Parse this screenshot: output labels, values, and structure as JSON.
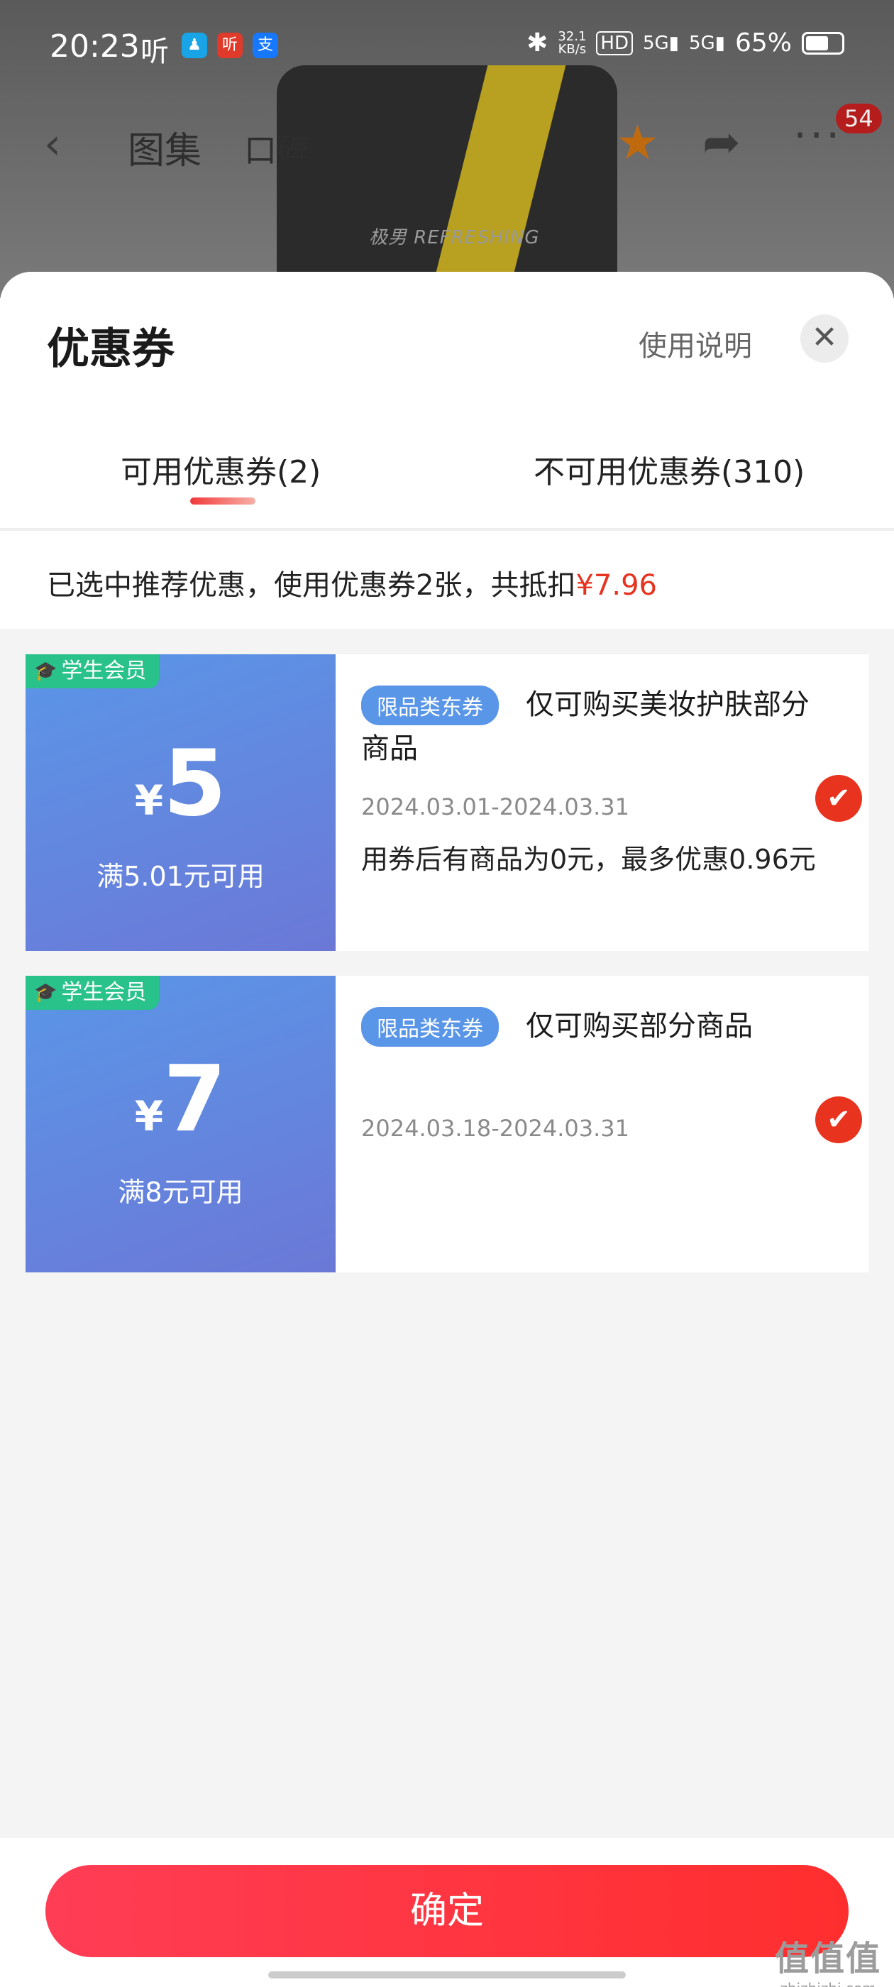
{
  "status_bar": {
    "time": "20:23",
    "ting": "听",
    "app_icons": [
      "qq-icon",
      "ting-app-icon",
      "alipay-icon"
    ],
    "net_speed_value": "32.1",
    "net_speed_unit": "KB/s",
    "battery": "65%",
    "battery_level": 0.65
  },
  "navbar": {
    "tabs": [
      "图集",
      "口碑"
    ],
    "more_badge": "54"
  },
  "product": {
    "visible_text": "极男  REFRESHING"
  },
  "sheet": {
    "title": "优惠券",
    "help_label": "使用说明",
    "close_label": "✕",
    "tabs": {
      "available": "可用优惠券(2)",
      "unavailable": "不可用优惠券(310)"
    },
    "summary": {
      "text": "已选中推荐优惠，使用优惠券2张，共抵扣",
      "amount": "¥7.96"
    }
  },
  "coupons": [
    {
      "member_tag": "学生会员",
      "yen": "¥",
      "amount": "5",
      "threshold": "满5.01元可用",
      "type_tag": "限品类东券",
      "description": "仅可购买美妆护肤部分商品",
      "validity": "2024.03.01-2024.03.31",
      "note": "用券后有商品为0元，最多优惠0.96元",
      "selected": true
    },
    {
      "member_tag": "学生会员",
      "yen": "¥",
      "amount": "7",
      "threshold": "满8元可用",
      "type_tag": "限品类东券",
      "description": "仅可购买部分商品",
      "validity": "2024.03.18-2024.03.31",
      "note": "",
      "selected": true
    }
  ],
  "footer": {
    "confirm_label": "确定",
    "watermark": "值值值",
    "watermark_url": "zhizhizhi.com"
  },
  "colors": {
    "accent_red": "#e8331e",
    "coupon_blue": "#5a96e8",
    "member_green": "#28c28a"
  }
}
